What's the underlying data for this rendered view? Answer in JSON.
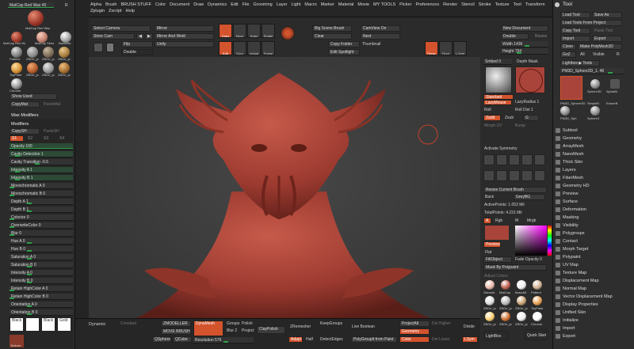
{
  "menu": [
    "Alpha",
    "Brush",
    "BRUSH STUFF",
    "Color",
    "Document",
    "Draw",
    "Dynamics",
    "Edit",
    "File",
    "Grooming",
    "Layer",
    "Light",
    "Macro",
    "Marker",
    "Material",
    "Movie",
    "MY TOOLS",
    "Picker",
    "Preferences",
    "Render",
    "Stencil",
    "Stroke",
    "Texture",
    "Tool",
    "Transform",
    "Zplugin",
    "Zscript",
    "Help"
  ],
  "left_top": {
    "matcap_slider": "MatCap Red Wax 45",
    "matcap_label": "MatCap Red Wax",
    "r_label": "R",
    "materials": [
      "MatCap Red Wa",
      "MatCap Skinsha",
      "BasicMa",
      "Patterd",
      "ZBGe_jo",
      "ZBGe_jo",
      "ZBGe_jo",
      "ToyPlast",
      "ZBGe_jo",
      "ZBGe_jo",
      "ZBGe_jo",
      "Chrome"
    ],
    "show_used": "Show Used",
    "copy_mat": "CopyMat",
    "paste_mat": "PasteMat"
  },
  "wax": {
    "header": "Wax Modifiers",
    "modifiers_label": "Modifiers",
    "copy_sh": "CopySH",
    "paste_sh": "PasteSH",
    "sh_tabs": [
      "S1",
      "S2",
      "S3",
      "S4"
    ],
    "sliders": [
      {
        "label": "Opacity",
        "value": "100",
        "fraction": 1.0
      },
      {
        "label": "Cavity Detection",
        "value": "1",
        "fraction": 0.1
      },
      {
        "label": "Cavity Transition",
        "value": "-0.5",
        "fraction": 0.45
      },
      {
        "label": "Intensity A",
        "value": "1",
        "fraction": 0.1
      },
      {
        "label": "Intensity B",
        "value": "1",
        "fraction": 0.1
      },
      {
        "label": "Monochromatic A",
        "value": "0",
        "fraction": 0.0
      },
      {
        "label": "Monochromatic B",
        "value": "0",
        "fraction": 0.0
      },
      {
        "label": "Depth A",
        "value": "1",
        "fraction": 0.3
      },
      {
        "label": "Depth B",
        "value": "1",
        "fraction": 0.3
      },
      {
        "label": "Colorize",
        "value": "0",
        "fraction": 0.0
      },
      {
        "label": "OverwriteColor",
        "value": "0",
        "fraction": 0.0
      },
      {
        "label": "Blur",
        "value": "0",
        "fraction": 0.0
      },
      {
        "label": "Hue A",
        "value": "0",
        "fraction": 0.3
      },
      {
        "label": "Hue B",
        "value": "0",
        "fraction": 0.3
      },
      {
        "label": "Saturation A",
        "value": "0",
        "fraction": 0.3
      },
      {
        "label": "Saturation B",
        "value": "0",
        "fraction": 0.3
      },
      {
        "label": "Intensity A",
        "value": "0",
        "fraction": 0.3
      },
      {
        "label": "Intensity B",
        "value": "0",
        "fraction": 0.3
      },
      {
        "label": "Retain HighColor A",
        "value": "0",
        "fraction": 0.0
      },
      {
        "label": "Retain HighColor B",
        "value": "0",
        "fraction": 0.0
      },
      {
        "label": "Orientation A",
        "value": "0",
        "fraction": 0.3
      },
      {
        "label": "Orientation B",
        "value": "0",
        "fraction": 0.3
      }
    ],
    "cells": [
      "Black",
      "",
      "Black",
      "Gold"
    ],
    "texture_label": "Texture"
  },
  "toolbar": {
    "select_camera": "Select Camera",
    "store_cam": "Store Cam",
    "mirror": "Mirror",
    "mirror_weld": "Mirror And Weld",
    "flip": "Flip",
    "unify": "Unify",
    "double": "Double",
    "icons": [
      "Draw",
      "Move",
      "Scale",
      "Rotate",
      "Edit",
      "Gyro",
      "Actual",
      "Frame",
      "Persp",
      "Floor",
      "L.Sym"
    ],
    "big_scene_brush": "Big Scene Brush",
    "clear": "Clear",
    "copy_folder": "Copy Folder",
    "edit_spotlight": "Edit Spotlight",
    "camview_on": "CamView On",
    "next": "Next",
    "thumbnail": "Thumbnail",
    "new_document": "New Document",
    "double_doc": "Double",
    "resize": "Resize",
    "width": "Width 1436",
    "height": "Height 794"
  },
  "right_side": {
    "smbed": "Smbed 0",
    "depth_mask": "Depth Mask",
    "standard": "Standard",
    "lazy_mouse": "LazyMouse",
    "lazy_radius": "LazyRadius 1",
    "roll": "Roll",
    "roll_dist": "Roll Dist 1",
    "zadd": "Zadd",
    "zsub": "Zsub",
    "zsub_val": "G",
    "morph_uv": "Morph UV",
    "bump": "Bump",
    "activate_symmetry": "Activate Symmetry",
    "resize_current": "Resize Current Brush",
    "back": "Back",
    "grey_bg": "GreyBG",
    "active_points": "ActivePoints: 1.053 Mil",
    "total_points": "TotalPoints: 4.231 Mil",
    "a_label": "A",
    "rgb": "Rgb",
    "m": "M",
    "mrgb": "Mrgb",
    "preview": "Preview",
    "flat": "Flat",
    "fill_object": "FillObject",
    "fade_opacity": "Fade Opacity 0",
    "mask_by_polypaint": "Mask By Polypaint",
    "adjust_colors": "Adjust Colors",
    "mats": [
      "Skinshd",
      "MatCap",
      "BasicMt",
      "Patterd",
      "ZBGe_jo",
      "ZBGe_jo",
      "ZBGe_jo",
      "ToyPlast",
      "ZBGe_jo",
      "ZBGe_jo",
      "ZBGe_jo",
      "Chrome"
    ],
    "lightbox": "LightBox",
    "quick_sketch": "Quick Sketch"
  },
  "tool": {
    "title": "Tool",
    "load_tool": "Load Tool",
    "save_as": "Save As",
    "load_from_project": "Load Tools From Project",
    "copy_tool": "Copy Tool",
    "paste_tool": "Paste Tool",
    "import": "Import",
    "export": "Export",
    "clone": "Clone",
    "make_polymesh": "Make PolyMesh3D",
    "goz": "GoZ",
    "all": "All",
    "visible": "Visible",
    "r": "R",
    "lightbox_tools": "Lightbox ▶ Tools",
    "current_tool": "PM3D_Sphere3D_1. 48",
    "tool_thumbs": [
      "PM3D_Sphere3D",
      "Sphere3D",
      "AlphaBr",
      "SimpleB",
      "EraserB",
      "PM3D_Sph",
      "Sphere3"
    ],
    "subpalettes": [
      "Subtool",
      "Geometry",
      "ArrayMesh",
      "NanoMesh",
      "Thick Skin",
      "Layers",
      "FiberMesh",
      "Geometry HD",
      "Preview",
      "Surface",
      "Deformation",
      "Masking",
      "Visibility",
      "Polygroups",
      "Contact",
      "Morph Target",
      "Polypaint",
      "UV Map",
      "Texture Map",
      "Displacement Map",
      "Normal Map",
      "Vector Displacement Map",
      "Display Properties",
      "Unified Skin",
      "Initialize",
      "Import",
      "Export"
    ]
  },
  "bottom": {
    "dynamic": "Dynamic",
    "constant": "Constant",
    "zmodeller": "ZMODELLER",
    "move_brush": "MOVE BRUSH",
    "qsphere": "QSphere",
    "qcube": "QCube",
    "dynamesh": "DynaMesh",
    "groups": "Groups",
    "polish": "Polish",
    "blur": "Blur 2",
    "project": "Project",
    "resolution": "Resolution 576",
    "claypolish": "ClayPolish",
    "zremesher": "ZRemesher",
    "adapt": "Adapt",
    "half": "Half",
    "keep_groups": "KeepGroups",
    "detect_edges": "DetectEdges",
    "live_boolean": "Live Boolean",
    "polygroup_from_paint": "PolyGroupIt from Paint",
    "project_all": "ProjectAll",
    "geometry": "Geometry",
    "color": "Color",
    "del_higher": "Del Higher",
    "del_lower": "Del Lower",
    "divide": "Divide",
    "lsym": "LSym"
  },
  "colors": {
    "accent": "#d3532d",
    "slider_green": "#2fa24c",
    "model": "#a9443a",
    "canvas": "#3d3d3d"
  }
}
